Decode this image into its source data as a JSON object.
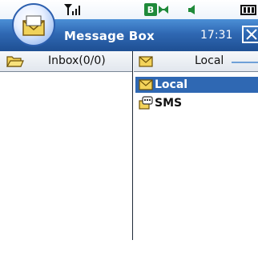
{
  "status_bar": {
    "icons": [
      "signal-icon",
      "bluetooth-icon",
      "speaker-icon",
      "battery-icon"
    ],
    "bluetooth_glyph": "B"
  },
  "title_bar": {
    "app_title": "Message Box",
    "time": "17:31"
  },
  "left_pane": {
    "folder_label": "Inbox(0/0)"
  },
  "right_pane": {
    "dropdown_label": "Local",
    "tree": [
      {
        "label": "Local",
        "selected": true,
        "icon": "envelope-icon"
      },
      {
        "label": "SMS",
        "selected": false,
        "icon": "sms-icon"
      }
    ]
  },
  "colors": {
    "titlebar": "#2f68b3",
    "selection": "#2f68b3",
    "status_green": "#1f8a3a"
  }
}
